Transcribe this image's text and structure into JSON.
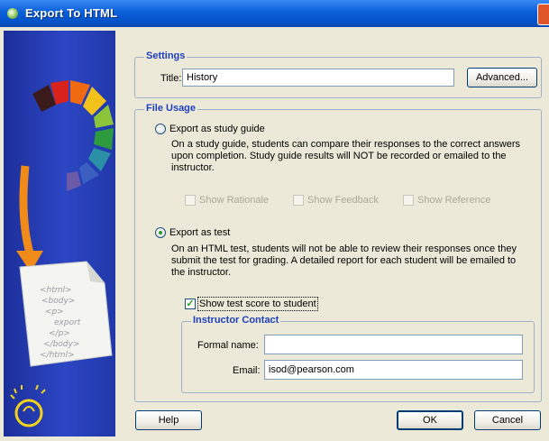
{
  "window": {
    "title": "Export To HTML"
  },
  "settings": {
    "group_title": "Settings",
    "title_label": "Title:",
    "title_value": "History",
    "advanced_label": "Advanced..."
  },
  "file_usage": {
    "group_title": "File Usage",
    "study_guide": {
      "label": "Export as study guide",
      "selected": false,
      "description": "On a study guide, students can compare their responses to the correct answers upon completion.  Study guide results will NOT be recorded or emailed to the instructor.",
      "options": [
        {
          "label": "Show Rationale",
          "checked": false,
          "enabled": false
        },
        {
          "label": "Show Feedback",
          "checked": false,
          "enabled": false
        },
        {
          "label": "Show Reference",
          "checked": false,
          "enabled": false
        }
      ]
    },
    "test": {
      "label": "Export as test",
      "selected": true,
      "description": "On an HTML test, students will not be able to review their responses once they submit the test for grading.  A detailed report for each student will be emailed to the instructor.",
      "show_score_label": "Show test score to student",
      "show_score_checked": true
    },
    "instructor": {
      "group_title": "Instructor Contact",
      "formal_name_label": "Formal name:",
      "formal_name_value": "",
      "email_label": "Email:",
      "email_value": "isod@pearson.com"
    }
  },
  "footer": {
    "help_label": "Help",
    "ok_label": "OK",
    "cancel_label": "Cancel"
  },
  "sidebar_art": {
    "document_lines": [
      "<html>",
      "<body>",
      "<p>",
      "export",
      "</p>",
      "</body>",
      "</html>"
    ]
  },
  "colors": {
    "accent": "#1f3fbf",
    "title_bar": "#0a5fd8",
    "sidebar": "#2c46c4"
  }
}
